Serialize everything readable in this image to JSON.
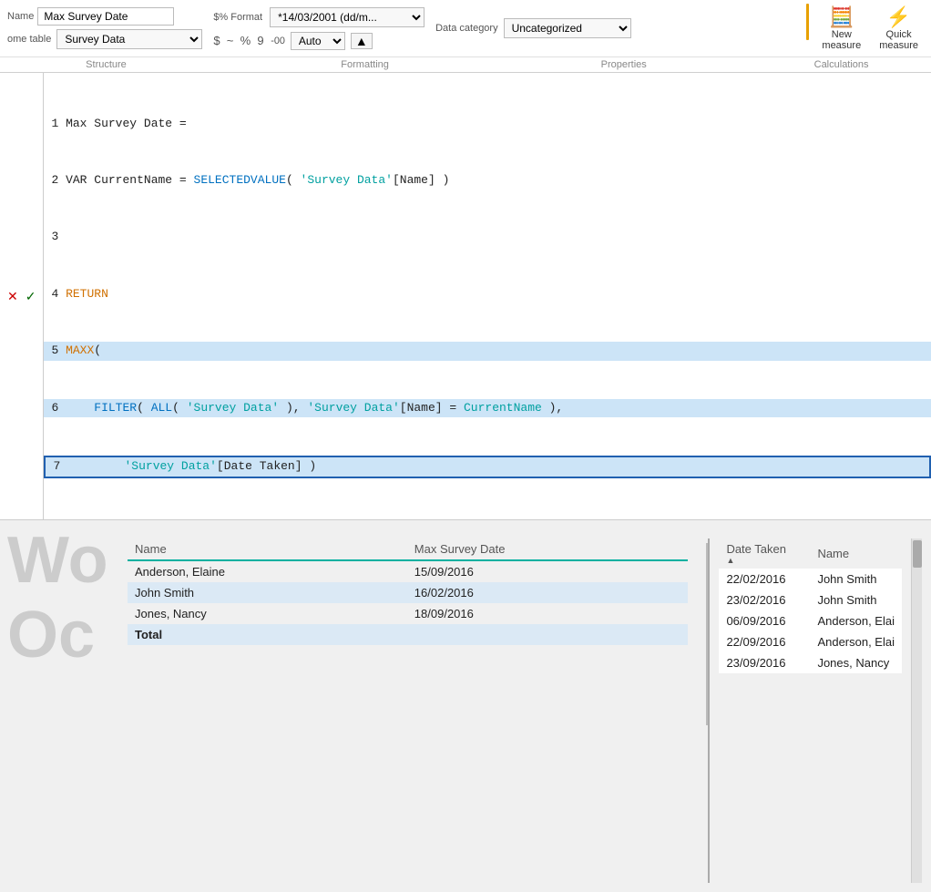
{
  "ribbon": {
    "field_label": "Name",
    "field_value": "Max Survey Date",
    "home_table_label": "ome table",
    "home_table_value": "Survey Data",
    "format_label": "$% Format",
    "format_value": "*14/03/2001 (dd/m...",
    "format_symbols": [
      "$",
      "~",
      "%",
      "9",
      "-00"
    ],
    "auto_label": "Auto",
    "data_category_label": "Data category",
    "data_category_value": "Uncategorized",
    "new_measure_label": "New\nmeasure",
    "quick_measure_label": "Quick\nmeasure",
    "sections": [
      {
        "label": "Structure"
      },
      {
        "label": "Formatting"
      },
      {
        "label": "Properties"
      },
      {
        "label": "Calculations"
      }
    ]
  },
  "formula": {
    "lines": [
      {
        "num": 1,
        "content": "Max Survey Date =",
        "highlight": false
      },
      {
        "num": 2,
        "content": "VAR CurrentName = SELECTEDVALUE( 'Survey Data'[Name] )",
        "highlight": false
      },
      {
        "num": 3,
        "content": "",
        "highlight": false
      },
      {
        "num": 4,
        "content": "RETURN",
        "highlight": false
      },
      {
        "num": 5,
        "content": "MAXX(",
        "highlight": true
      },
      {
        "num": 6,
        "content": "    FILTER( ALL( 'Survey Data' ), 'Survey Data'[Name] = CurrentName ),",
        "highlight": true
      },
      {
        "num": 7,
        "content": "        'Survey Data'[Date Taken] )",
        "highlight": true
      }
    ]
  },
  "left_table": {
    "headers": [
      "Name",
      "Max Survey Date"
    ],
    "rows": [
      {
        "name": "Anderson, Elaine",
        "date": "15/09/2016",
        "even": false
      },
      {
        "name": "John Smith",
        "date": "16/02/2016",
        "even": true
      },
      {
        "name": "Jones, Nancy",
        "date": "18/09/2016",
        "even": false
      }
    ],
    "total_label": "Total"
  },
  "right_table": {
    "headers": [
      "Date Taken",
      "Name"
    ],
    "rows": [
      {
        "date": "22/02/2016",
        "name": "John Smith"
      },
      {
        "date": "23/02/2016",
        "name": "John Smith"
      },
      {
        "date": "06/09/2016",
        "name": "Anderson, Elai"
      },
      {
        "date": "22/09/2016",
        "name": "Anderson, Elai"
      },
      {
        "date": "23/09/2016",
        "name": "Jones, Nancy"
      }
    ]
  },
  "big_text": {
    "wo": "Wo",
    "oc": "Oc"
  }
}
